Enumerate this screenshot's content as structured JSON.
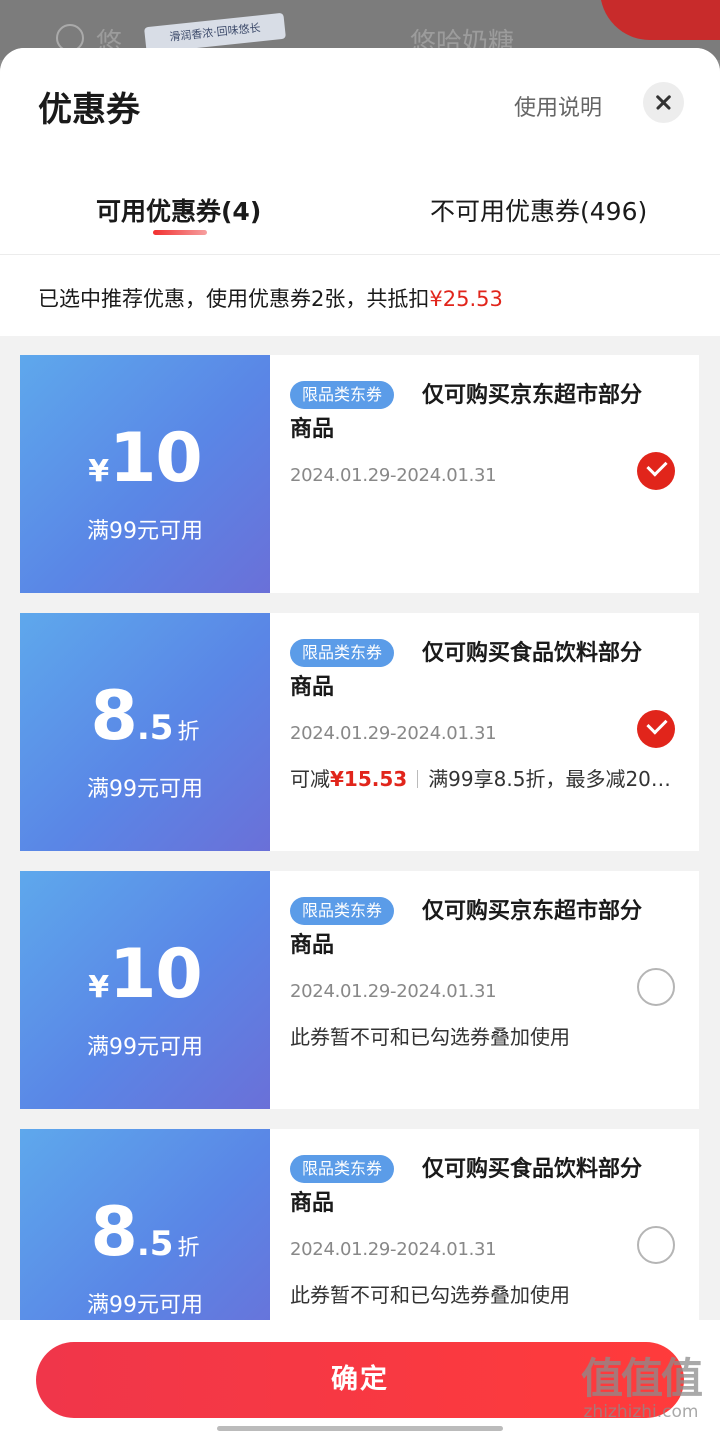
{
  "background": {
    "ribbon_text": "滑润香浓·回味悠长",
    "text_left": "悠",
    "text_right": "悠哈奶糖"
  },
  "sheet": {
    "title": "优惠券",
    "help_link": "使用说明",
    "close_icon": "close-icon"
  },
  "tabs": [
    {
      "label": "可用优惠券(4)",
      "active": true
    },
    {
      "label": "不可用优惠券(496)",
      "active": false
    }
  ],
  "summary": {
    "prefix": "已选中推荐优惠，使用优惠券2张，共抵扣",
    "amount": "¥25.53"
  },
  "coupons": [
    {
      "currency": "¥",
      "amount": "10",
      "unit": "",
      "condition": "满99元可用",
      "tag": "限品类东券",
      "description": "仅可购买京东超市部分商品",
      "date": "2024.01.29-2024.01.31",
      "checked": true,
      "note": ""
    },
    {
      "currency": "",
      "amount": "8",
      "amount_dec": ".5",
      "unit": "折",
      "condition": "满99元可用",
      "tag": "限品类东券",
      "description": "仅可购买食品饮料部分商品",
      "date": "2024.01.29-2024.01.31",
      "checked": true,
      "note_prefix": "可减",
      "note_amount": "¥15.53",
      "note_detail": "满99享8.5折，最多减20…"
    },
    {
      "currency": "¥",
      "amount": "10",
      "unit": "",
      "condition": "满99元可用",
      "tag": "限品类东券",
      "description": "仅可购买京东超市部分商品",
      "date": "2024.01.29-2024.01.31",
      "checked": false,
      "note": "此券暂不可和已勾选券叠加使用"
    },
    {
      "currency": "",
      "amount": "8",
      "amount_dec": ".5",
      "unit": "折",
      "condition": "满99元可用",
      "tag": "限品类东券",
      "description": "仅可购买食品饮料部分商品",
      "date": "2024.01.29-2024.01.31",
      "checked": false,
      "note": "此券暂不可和已勾选券叠加使用"
    }
  ],
  "footer": {
    "confirm_label": "确定"
  },
  "watermark": {
    "logo": "值值值",
    "url": "zhizhizhi.com"
  },
  "colors": {
    "accent_red": "#e1251b",
    "coupon_blue": "#5a86e6",
    "tag_blue": "#5b9ce8"
  }
}
